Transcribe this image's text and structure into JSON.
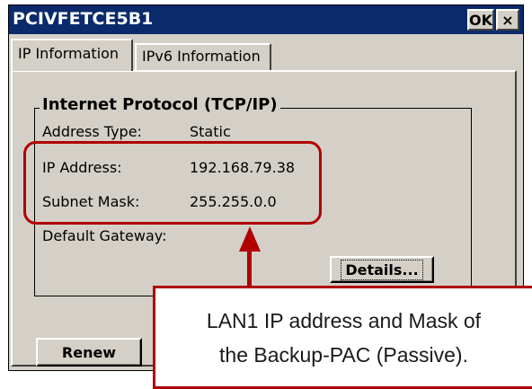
{
  "window": {
    "title": "PCIVFETCE5B1",
    "ok_label": "OK",
    "close_label": "×"
  },
  "tabs": [
    {
      "label": "IP Information",
      "active": true
    },
    {
      "label": "IPv6 Information",
      "active": false
    }
  ],
  "group": {
    "title": "Internet Protocol (TCP/IP)",
    "rows": [
      {
        "label": "Address Type:",
        "value": "Static"
      },
      {
        "label": "IP Address:",
        "value": "192.168.79.38"
      },
      {
        "label": "Subnet Mask:",
        "value": "255.255.0.0"
      },
      {
        "label": "Default Gateway:",
        "value": ""
      }
    ]
  },
  "buttons": {
    "details_label": "Details...",
    "renew_label": "Renew"
  },
  "annotation": {
    "line1": "LAN1 IP address and Mask of",
    "line2": "the Backup-PAC (Passive).",
    "color": "#b00000"
  },
  "colors": {
    "titlebar": "#0a2a6b",
    "face": "#d4d0c8"
  }
}
